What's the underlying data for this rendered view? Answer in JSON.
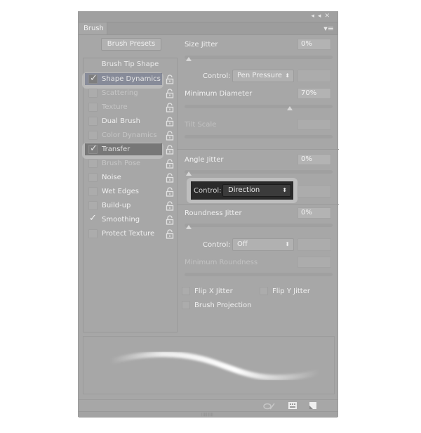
{
  "window": {
    "collapse_icon": "double-chevron-left-icon",
    "close_icon": "close-icon",
    "tab_label": "Brush",
    "panel_menu_icon": "panel-menu-icon"
  },
  "left": {
    "presets_button": "Brush Presets",
    "tip_shape_label": "Brush Tip Shape",
    "items": [
      {
        "label": "Shape Dynamics",
        "checked": true,
        "state": "selected-blue"
      },
      {
        "label": "Scattering",
        "checked": false,
        "state": "dim"
      },
      {
        "label": "Texture",
        "checked": false,
        "state": "dim"
      },
      {
        "label": "Dual Brush",
        "checked": false,
        "state": "normal"
      },
      {
        "label": "Color Dynamics",
        "checked": false,
        "state": "dim"
      },
      {
        "label": "Transfer",
        "checked": true,
        "state": "selected-dark"
      },
      {
        "label": "Brush Pose",
        "checked": false,
        "state": "dim"
      },
      {
        "label": "Noise",
        "checked": false,
        "state": "normal"
      },
      {
        "label": "Wet Edges",
        "checked": false,
        "state": "normal"
      },
      {
        "label": "Build-up",
        "checked": false,
        "state": "normal"
      },
      {
        "label": "Smoothing",
        "checked": true,
        "state": "normal"
      },
      {
        "label": "Protect Texture",
        "checked": false,
        "state": "normal"
      }
    ]
  },
  "right": {
    "size_jitter": {
      "label": "Size Jitter",
      "value": "0%",
      "slider_percent": 0
    },
    "size_control": {
      "label": "Control:",
      "value": "Pen Pressure"
    },
    "min_diameter": {
      "label": "Minimum Diameter",
      "value": "70%",
      "slider_percent": 70
    },
    "tilt_scale": {
      "label": "Tilt Scale",
      "value": ""
    },
    "angle_jitter": {
      "label": "Angle Jitter",
      "value": "0%",
      "slider_percent": 0
    },
    "angle_control": {
      "label": "Control:",
      "value": "Direction"
    },
    "roundness_jitter": {
      "label": "Roundness Jitter",
      "value": "0%",
      "slider_percent": 0
    },
    "roundness_control": {
      "label": "Control:",
      "value": "Off"
    },
    "min_roundness": {
      "label": "Minimum Roundness",
      "value": ""
    },
    "flip_x": {
      "label": "Flip X Jitter",
      "checked": false
    },
    "flip_y": {
      "label": "Flip Y Jitter",
      "checked": false
    },
    "projection": {
      "label": "Brush Projection",
      "checked": false
    }
  },
  "bottom": {
    "icons": [
      "toggle-live-tip-preview-icon",
      "open-preset-manager-icon",
      "create-new-brush-icon"
    ]
  },
  "glyphs": {
    "check": "✓",
    "updown": "⬍",
    "collapse": "◂◂",
    "close": "✕",
    "menu": "▾≡"
  }
}
